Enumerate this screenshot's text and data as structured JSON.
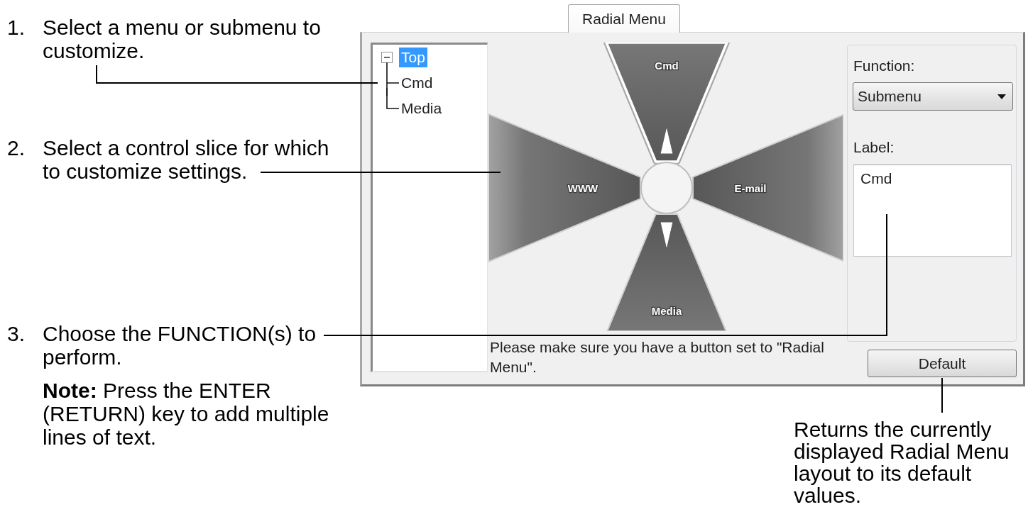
{
  "annotations": [
    {
      "number": "1.",
      "text": "Select a menu or submenu to customize."
    },
    {
      "number": "2.",
      "text": "Select a control slice for which to customize settings."
    },
    {
      "number": "3.",
      "text": "Choose the FUNCTION(s) to perform.",
      "note": "**Note:** Press the ENTER (RETURN) key to add multiple lines of text."
    }
  ],
  "tabs": [
    {
      "label": "Radial Menu",
      "selected": true
    }
  ],
  "tree": [
    {
      "label": "Top",
      "selected": true,
      "expanded": true,
      "children": [
        {
          "label": "Cmd",
          "selected": false
        },
        {
          "label": "Media",
          "selected": false
        }
      ]
    }
  ],
  "radial_menu": {
    "slices": [
      {
        "label": "Cmd",
        "selected": true,
        "submenu": true
      },
      {
        "label": "E-mail",
        "selected": false,
        "submenu": false
      },
      {
        "label": "Media",
        "selected": false,
        "submenu": true
      },
      {
        "label": "WWW",
        "selected": false,
        "submenu": false
      }
    ]
  },
  "function_field": {
    "label": "Function:",
    "value": "Submenu"
  },
  "label_field": {
    "label": "Label:",
    "value": "Cmd"
  },
  "hint": "Please make sure you have a button set to \"Radial Menu\".",
  "default_button": "Default",
  "default_caption": "Returns the currently displayed Radial Menu layout to its default values."
}
